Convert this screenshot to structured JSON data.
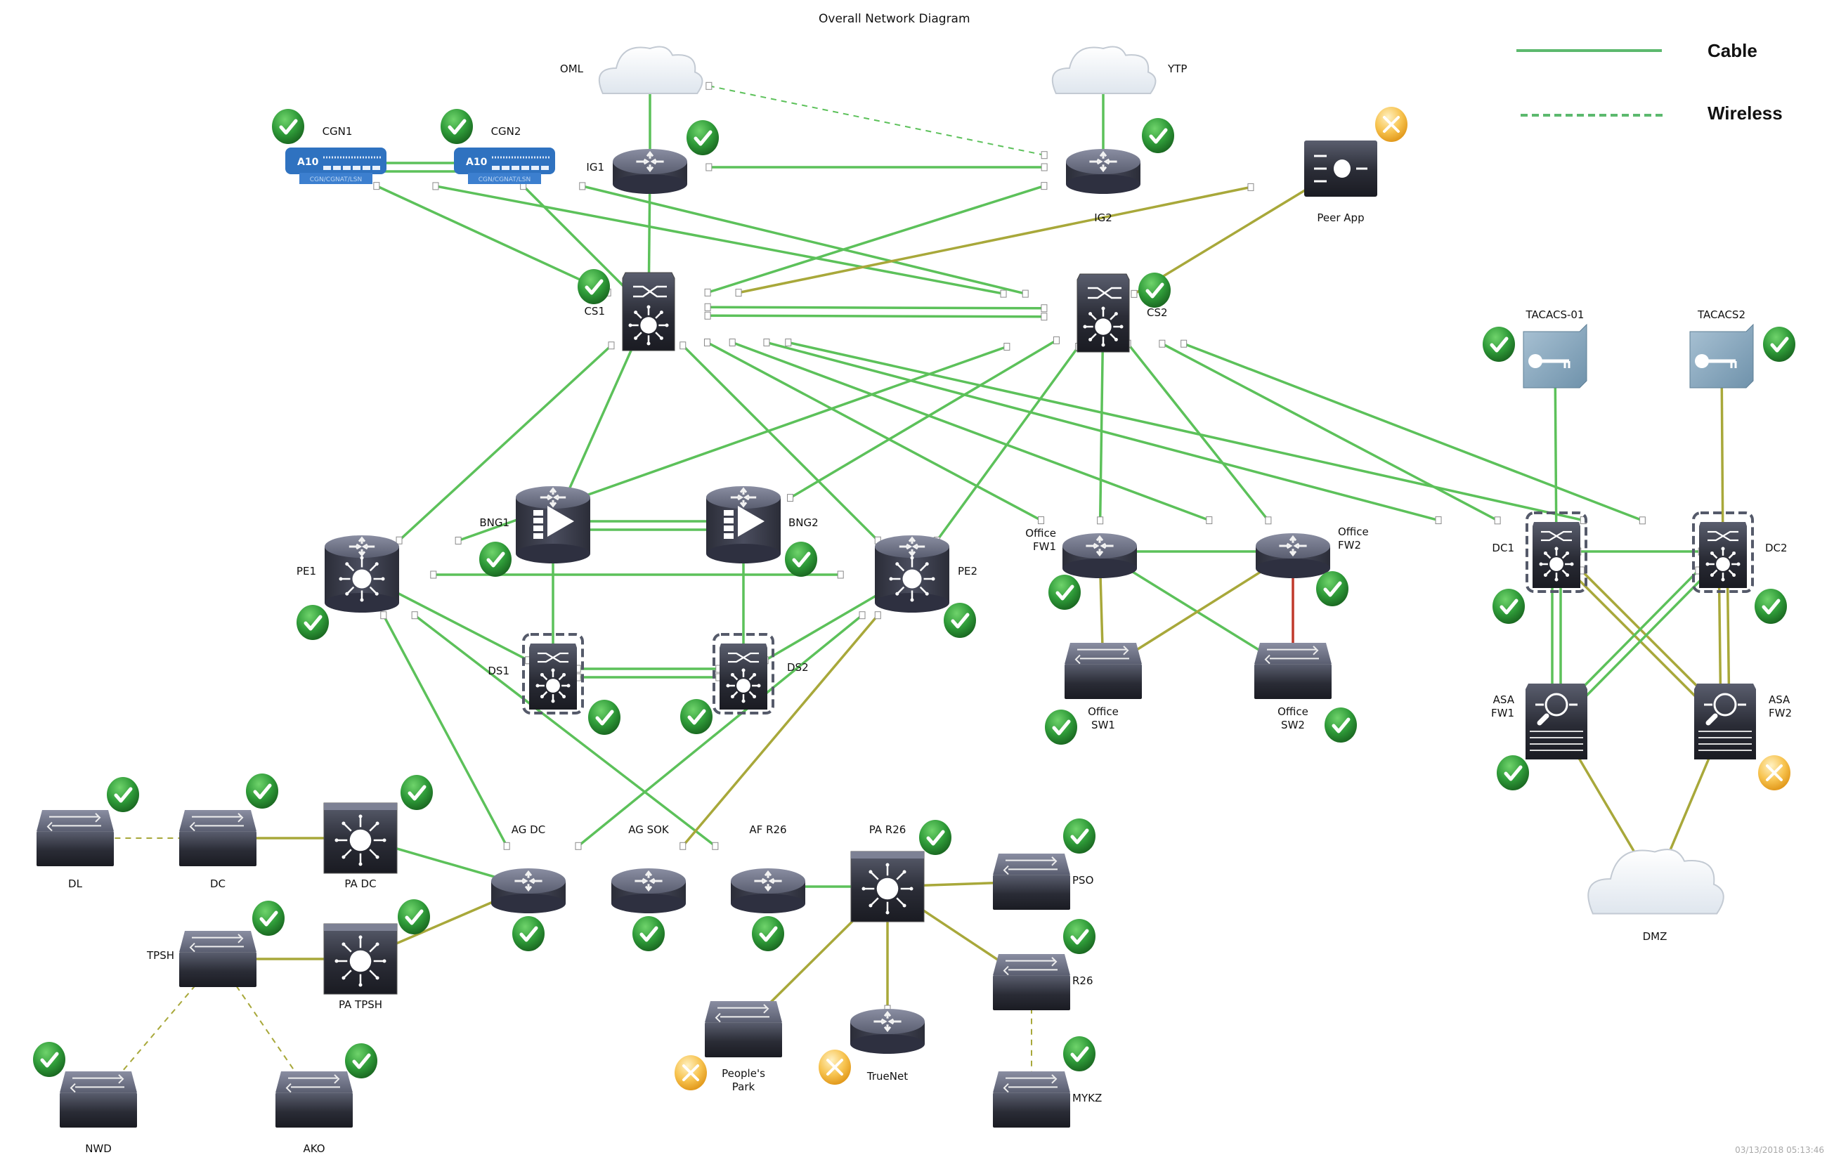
{
  "title": "Overall Network Diagram",
  "legend": {
    "items": [
      {
        "label": "Cable",
        "style": "solid"
      },
      {
        "label": "Wireless",
        "style": "dashed"
      }
    ]
  },
  "timestamp": "03/13/2018 05:13:46",
  "colors": {
    "cable_ok": "#5cc15a",
    "cable_warn": "#a8a83a",
    "cable_down": "#c0392b",
    "status_ok": "#2e9a38",
    "status_maintenance": "#f5b942",
    "device_dark": "#3b3e4c",
    "tacacs_blue": "#86a8c0",
    "a10_blue": "#2f72c0"
  },
  "nodes": [
    {
      "id": "OML",
      "label": "OML",
      "type": "cloud",
      "status": null
    },
    {
      "id": "YTP",
      "label": "YTP",
      "type": "cloud",
      "status": null
    },
    {
      "id": "IG1",
      "label": "IG1",
      "type": "router",
      "status": "ok"
    },
    {
      "id": "IG2",
      "label": "IG2",
      "type": "router",
      "status": "ok"
    },
    {
      "id": "CGN1",
      "label": "CGN1",
      "type": "a10",
      "sublabel": "CGN/CGNAT/LSN",
      "status": "ok"
    },
    {
      "id": "CGN2",
      "label": "CGN2",
      "type": "a10",
      "sublabel": "CGN/CGNAT/LSN",
      "status": "ok"
    },
    {
      "id": "PEER",
      "label": "Peer App",
      "type": "appliance",
      "status": "maintenance"
    },
    {
      "id": "CS1",
      "label": "CS1",
      "type": "coreswitch",
      "status": "ok"
    },
    {
      "id": "CS2",
      "label": "CS2",
      "type": "coreswitch",
      "status": "ok"
    },
    {
      "id": "TAC1",
      "label": "TACACS-01",
      "type": "tacacs",
      "status": "ok"
    },
    {
      "id": "TAC2",
      "label": "TACACS2",
      "type": "tacacs",
      "status": "ok"
    },
    {
      "id": "PE1",
      "label": "PE1",
      "type": "l3router",
      "status": "ok"
    },
    {
      "id": "PE2",
      "label": "PE2",
      "type": "l3router",
      "status": "ok"
    },
    {
      "id": "BNG1",
      "label": "BNG1",
      "type": "bng",
      "status": "ok"
    },
    {
      "id": "BNG2",
      "label": "BNG2",
      "type": "bng",
      "status": "ok"
    },
    {
      "id": "DS1",
      "label": "DS1",
      "type": "stackswitch",
      "status": "ok"
    },
    {
      "id": "DS2",
      "label": "DS2",
      "type": "stackswitch",
      "status": "ok"
    },
    {
      "id": "OFW1",
      "label": "Office\nFW1",
      "type": "router",
      "status": "ok"
    },
    {
      "id": "OFW2",
      "label": "Office\nFW2",
      "type": "router",
      "status": "ok"
    },
    {
      "id": "OSW1",
      "label": "Office\nSW1",
      "type": "switch",
      "status": "ok"
    },
    {
      "id": "OSW2",
      "label": "Office\nSW2",
      "type": "switch",
      "status": "ok"
    },
    {
      "id": "DC1",
      "label": "DC1",
      "type": "stackswitch",
      "status": "ok"
    },
    {
      "id": "DC2",
      "label": "DC2",
      "type": "stackswitch",
      "status": "ok"
    },
    {
      "id": "ASA1",
      "label": "ASA\nFW1",
      "type": "firewall",
      "status": "ok"
    },
    {
      "id": "ASA2",
      "label": "ASA\nFW2",
      "type": "firewall",
      "status": "maintenance"
    },
    {
      "id": "DMZ",
      "label": "DMZ",
      "type": "cloud",
      "status": null
    },
    {
      "id": "DL",
      "label": "DL",
      "type": "switch",
      "status": "ok"
    },
    {
      "id": "DCs",
      "label": "DC",
      "type": "switch",
      "status": "ok"
    },
    {
      "id": "PADC",
      "label": "PA DC",
      "type": "l3box",
      "status": "ok"
    },
    {
      "id": "TPSH",
      "label": "TPSH",
      "type": "switch",
      "status": "ok"
    },
    {
      "id": "PATPSH",
      "label": "PA TPSH",
      "type": "l3box",
      "status": "ok"
    },
    {
      "id": "NWD",
      "label": "NWD",
      "type": "switch",
      "status": "ok"
    },
    {
      "id": "AKO",
      "label": "AKO",
      "type": "switch",
      "status": "ok"
    },
    {
      "id": "AGDC",
      "label": "AG DC",
      "type": "router",
      "status": "ok"
    },
    {
      "id": "AGSOK",
      "label": "AG SOK",
      "type": "router",
      "status": "ok"
    },
    {
      "id": "AFR26",
      "label": "AF R26",
      "type": "router",
      "status": "ok"
    },
    {
      "id": "PAR26",
      "label": "PA R26",
      "type": "l3box",
      "status": "ok"
    },
    {
      "id": "PSO",
      "label": "PSO",
      "type": "switch",
      "status": "ok"
    },
    {
      "id": "R26",
      "label": "R26",
      "type": "switch",
      "status": "ok"
    },
    {
      "id": "MYKZ",
      "label": "MYKZ",
      "type": "switch",
      "status": "ok"
    },
    {
      "id": "PPARK",
      "label": "People's\nPark",
      "type": "switch",
      "status": "maintenance"
    },
    {
      "id": "TRUENET",
      "label": "TrueNet",
      "type": "router",
      "status": "maintenance"
    }
  ],
  "links": [
    {
      "from": "OML",
      "to": "IG1",
      "kind": "cable",
      "state": "ok"
    },
    {
      "from": "YTP",
      "to": "IG2",
      "kind": "cable",
      "state": "ok"
    },
    {
      "from": "OML",
      "to": "IG2",
      "kind": "wireless",
      "state": "ok"
    },
    {
      "from": "IG1",
      "to": "IG2",
      "kind": "cable",
      "state": "ok"
    },
    {
      "from": "CGN1",
      "to": "CGN2",
      "kind": "cable",
      "state": "ok"
    },
    {
      "from": "CGN1",
      "to": "CGN2",
      "kind": "cable",
      "state": "ok"
    },
    {
      "from": "IG1",
      "to": "CS1",
      "kind": "cable",
      "state": "ok"
    },
    {
      "from": "IG2",
      "to": "CS1",
      "kind": "cable",
      "state": "ok"
    },
    {
      "from": "CGN1",
      "to": "CS1",
      "kind": "cable",
      "state": "ok"
    },
    {
      "from": "CGN1",
      "to": "CS2",
      "kind": "cable",
      "state": "ok"
    },
    {
      "from": "CGN2",
      "to": "CS1",
      "kind": "cable",
      "state": "ok"
    },
    {
      "from": "CGN2",
      "to": "CS2",
      "kind": "cable",
      "state": "ok"
    },
    {
      "from": "PEER",
      "to": "CS1",
      "kind": "cable",
      "state": "warn"
    },
    {
      "from": "PEER",
      "to": "CS2",
      "kind": "cable",
      "state": "warn"
    },
    {
      "from": "CS1",
      "to": "CS2",
      "kind": "cable",
      "state": "ok"
    },
    {
      "from": "CS1",
      "to": "CS2",
      "kind": "cable",
      "state": "ok"
    },
    {
      "from": "CS1",
      "to": "PE1",
      "kind": "cable",
      "state": "ok"
    },
    {
      "from": "CS1",
      "to": "BNG1",
      "kind": "cable",
      "state": "ok"
    },
    {
      "from": "CS1",
      "to": "PE2",
      "kind": "cable",
      "state": "ok"
    },
    {
      "from": "CS1",
      "to": "OFW1",
      "kind": "cable",
      "state": "ok"
    },
    {
      "from": "CS1",
      "to": "OFW2",
      "kind": "cable",
      "state": "ok"
    },
    {
      "from": "CS1",
      "to": "DC1",
      "kind": "cable",
      "state": "ok"
    },
    {
      "from": "CS2",
      "to": "PE1",
      "kind": "cable",
      "state": "ok"
    },
    {
      "from": "CS2",
      "to": "BNG2",
      "kind": "cable",
      "state": "ok"
    },
    {
      "from": "CS2",
      "to": "PE2",
      "kind": "cable",
      "state": "ok"
    },
    {
      "from": "CS2",
      "to": "OFW1",
      "kind": "cable",
      "state": "ok"
    },
    {
      "from": "CS2",
      "to": "OFW2",
      "kind": "cable",
      "state": "ok"
    },
    {
      "from": "CS2",
      "to": "DC1",
      "kind": "cable",
      "state": "ok"
    },
    {
      "from": "CS2",
      "to": "DC2",
      "kind": "cable",
      "state": "ok"
    },
    {
      "from": "CS1",
      "to": "DC2",
      "kind": "cable",
      "state": "ok"
    },
    {
      "from": "TAC1",
      "to": "DC1",
      "kind": "cable",
      "state": "ok"
    },
    {
      "from": "TAC2",
      "to": "DC2",
      "kind": "cable",
      "state": "warn"
    },
    {
      "from": "BNG1",
      "to": "BNG2",
      "kind": "cable",
      "state": "ok"
    },
    {
      "from": "BNG1",
      "to": "BNG2",
      "kind": "cable",
      "state": "ok"
    },
    {
      "from": "PE1",
      "to": "PE2",
      "kind": "cable",
      "state": "ok"
    },
    {
      "from": "BNG1",
      "to": "DS1",
      "kind": "cable",
      "state": "ok"
    },
    {
      "from": "BNG2",
      "to": "DS2",
      "kind": "cable",
      "state": "ok"
    },
    {
      "from": "PE1",
      "to": "DS1",
      "kind": "cable",
      "state": "ok"
    },
    {
      "from": "PE2",
      "to": "DS2",
      "kind": "cable",
      "state": "ok"
    },
    {
      "from": "DS1",
      "to": "DS2",
      "kind": "cable",
      "state": "ok"
    },
    {
      "from": "DS1",
      "to": "DS2",
      "kind": "cable",
      "state": "ok"
    },
    {
      "from": "PE1",
      "to": "AGDC",
      "kind": "cable",
      "state": "ok"
    },
    {
      "from": "PE1",
      "to": "AFR26",
      "kind": "cable",
      "state": "ok"
    },
    {
      "from": "PE2",
      "to": "AGDC",
      "kind": "cable",
      "state": "ok"
    },
    {
      "from": "PE2",
      "to": "AGSOK",
      "kind": "cable",
      "state": "warn"
    },
    {
      "from": "OFW1",
      "to": "OFW2",
      "kind": "cable",
      "state": "ok"
    },
    {
      "from": "OFW1",
      "to": "OSW1",
      "kind": "cable",
      "state": "warn"
    },
    {
      "from": "OFW1",
      "to": "OSW2",
      "kind": "cable",
      "state": "ok"
    },
    {
      "from": "OFW2",
      "to": "OSW1",
      "kind": "cable",
      "state": "warn"
    },
    {
      "from": "OFW2",
      "to": "OSW2",
      "kind": "cable",
      "state": "down"
    },
    {
      "from": "DC1",
      "to": "DC2",
      "kind": "cable",
      "state": "ok"
    },
    {
      "from": "DC1",
      "to": "ASA1",
      "kind": "cable",
      "state": "ok"
    },
    {
      "from": "DC1",
      "to": "ASA1",
      "kind": "cable",
      "state": "ok"
    },
    {
      "from": "DC1",
      "to": "ASA2",
      "kind": "cable",
      "state": "warn"
    },
    {
      "from": "DC1",
      "to": "ASA2",
      "kind": "cable",
      "state": "warn"
    },
    {
      "from": "DC2",
      "to": "ASA1",
      "kind": "cable",
      "state": "ok"
    },
    {
      "from": "DC2",
      "to": "ASA1",
      "kind": "cable",
      "state": "ok"
    },
    {
      "from": "DC2",
      "to": "ASA2",
      "kind": "cable",
      "state": "warn"
    },
    {
      "from": "DC2",
      "to": "ASA2",
      "kind": "cable",
      "state": "warn"
    },
    {
      "from": "ASA1",
      "to": "DMZ",
      "kind": "cable",
      "state": "warn"
    },
    {
      "from": "ASA2",
      "to": "DMZ",
      "kind": "cable",
      "state": "warn"
    },
    {
      "from": "DL",
      "to": "DCs",
      "kind": "wireless",
      "state": "warn"
    },
    {
      "from": "DCs",
      "to": "PADC",
      "kind": "cable",
      "state": "warn"
    },
    {
      "from": "PADC",
      "to": "AGDC",
      "kind": "cable",
      "state": "ok"
    },
    {
      "from": "TPSH",
      "to": "PATPSH",
      "kind": "cable",
      "state": "warn"
    },
    {
      "from": "PATPSH",
      "to": "AGDC",
      "kind": "cable",
      "state": "warn"
    },
    {
      "from": "TPSH",
      "to": "NWD",
      "kind": "wireless",
      "state": "warn"
    },
    {
      "from": "TPSH",
      "to": "AKO",
      "kind": "wireless",
      "state": "warn"
    },
    {
      "from": "AFR26",
      "to": "PAR26",
      "kind": "cable",
      "state": "ok"
    },
    {
      "from": "PAR26",
      "to": "PSO",
      "kind": "cable",
      "state": "warn"
    },
    {
      "from": "PAR26",
      "to": "R26",
      "kind": "cable",
      "state": "warn"
    },
    {
      "from": "PAR26",
      "to": "PPARK",
      "kind": "cable",
      "state": "warn"
    },
    {
      "from": "PAR26",
      "to": "TRUENET",
      "kind": "cable",
      "state": "warn"
    },
    {
      "from": "R26",
      "to": "MYKZ",
      "kind": "wireless",
      "state": "warn"
    }
  ]
}
